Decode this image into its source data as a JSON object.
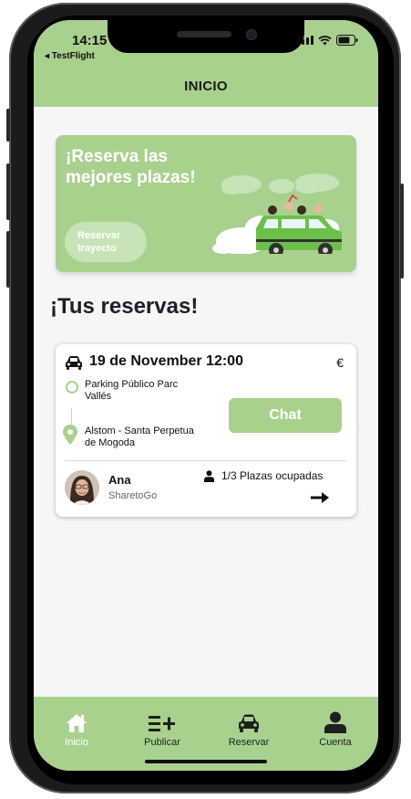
{
  "status_bar": {
    "time": "14:15",
    "back_app": "◂ TestFlight"
  },
  "header": {
    "title": "INICIO"
  },
  "promo": {
    "headline": "¡Reserva las mejores plazas!",
    "button_label": "Reservar trayecto",
    "illustration": "car-with-passengers-illustration"
  },
  "section": {
    "title": "¡Tus reservas!"
  },
  "booking": {
    "date_time": "19 de November 12:00",
    "currency": "€",
    "origin": "Parking Público Parc Vallés",
    "destination": "Alstom - Santa Perpetua de Mogoda",
    "chat_label": "Chat",
    "driver": {
      "name": "Ana",
      "company": "SharetoGo"
    },
    "seats": "1/3 Plazas ocupadas"
  },
  "tabbar": {
    "items": [
      {
        "label": "Inicio",
        "icon": "home-icon",
        "active": true
      },
      {
        "label": "Publicar",
        "icon": "publish-icon",
        "active": false
      },
      {
        "label": "Reservar",
        "icon": "car-icon",
        "active": false
      },
      {
        "label": "Cuenta",
        "icon": "user-icon",
        "active": false
      }
    ]
  },
  "colors": {
    "accent": "#a9d18e",
    "accent_light": "#c8e3b6",
    "background": "#f6f6f6",
    "text_dark": "#1e1e2c"
  }
}
